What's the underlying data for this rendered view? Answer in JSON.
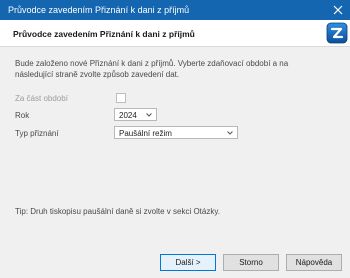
{
  "window": {
    "title": "Průvodce zavedením Přiznání k dani z příjmů"
  },
  "header": {
    "title": "Průvodce zavedením Přiznání k dani z příjmů",
    "logo_icon": "z-logo-icon"
  },
  "intro_text": "Bude založeno nové Přiznání k dani z příjmů. Vyberte zdaňovací období a na následující straně zvolte způsob zavedení dat.",
  "form": {
    "partial_period_label": "Za část období",
    "partial_period_checked": false,
    "year_label": "Rok",
    "year_value": "2024",
    "type_label": "Typ přiznání",
    "type_value": "Paušální režim"
  },
  "tip": "Tip: Druh tiskopisu paušální daně si zvolte v sekci Otázky.",
  "buttons": {
    "next": "Další >",
    "cancel": "Storno",
    "help": "Nápověda"
  },
  "colors": {
    "titlebar": "#1466b0",
    "primary_border": "#0078d7"
  }
}
